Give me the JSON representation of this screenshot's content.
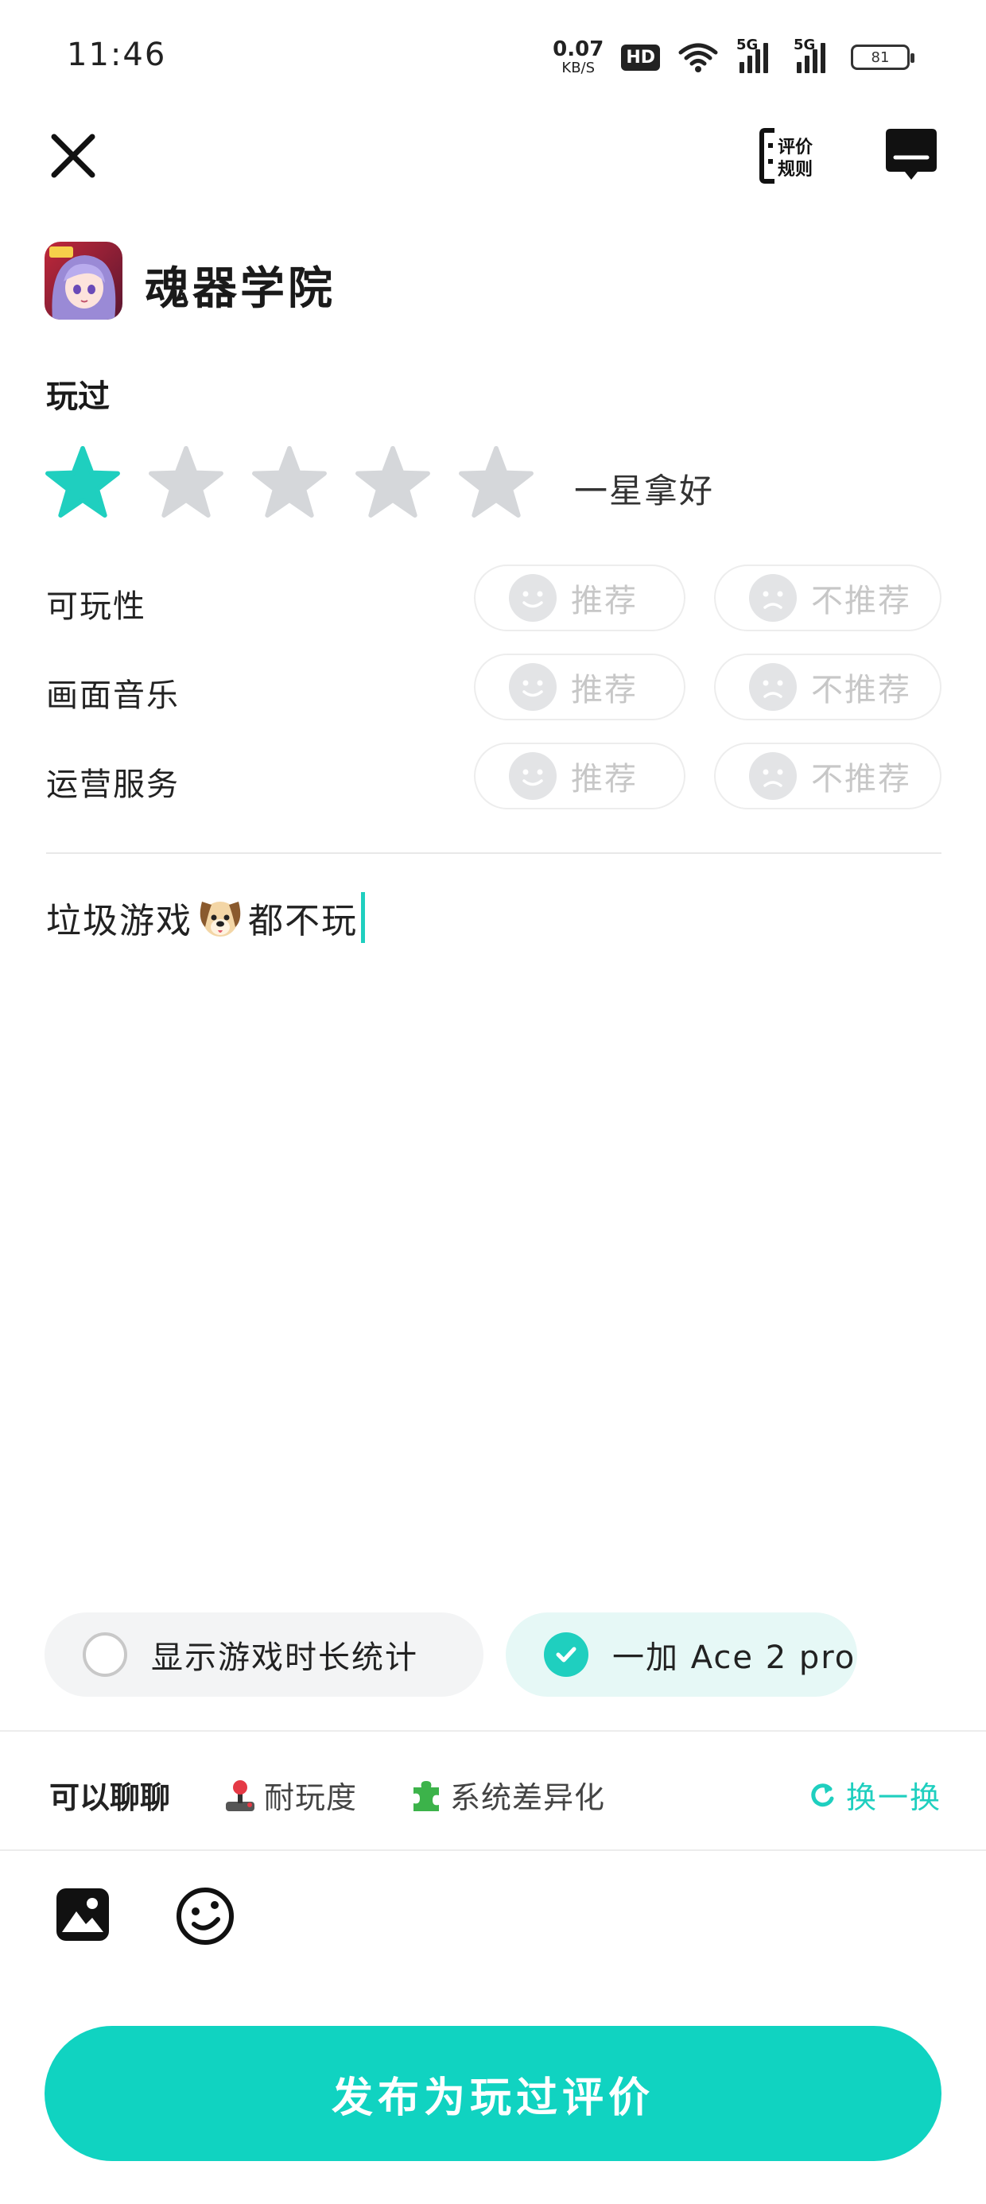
{
  "status_bar": {
    "time": "11:46",
    "net_speed_value": "0.07",
    "net_speed_unit": "KB/S",
    "hd_badge": "HD",
    "signal1_label": "5G",
    "signal2_label": "5G",
    "battery": "81"
  },
  "header": {
    "rules_label_line1": "评价",
    "rules_label_line2": "规则"
  },
  "game": {
    "title": "魂器学院"
  },
  "rating": {
    "section_label": "玩过",
    "stars_total": 5,
    "stars_selected": 1,
    "text": "一星拿好",
    "accent_color": "#1fcfbf",
    "inactive_color": "#d5d7da"
  },
  "aspects": [
    {
      "label": "可玩性",
      "recommend": "推荐",
      "not_recommend": "不推荐"
    },
    {
      "label": "画面音乐",
      "recommend": "推荐",
      "not_recommend": "不推荐"
    },
    {
      "label": "运营服务",
      "recommend": "推荐",
      "not_recommend": "不推荐"
    }
  ],
  "review": {
    "text_before_emoji": "垃圾游戏",
    "emoji": "dog-face",
    "text_after_emoji": "都不玩"
  },
  "options": {
    "playtime_label": "显示游戏时长统计",
    "playtime_checked": false,
    "device_label": "一加 Ace 2 pro",
    "device_checked": true
  },
  "topics": {
    "lead": "可以聊聊",
    "items": [
      {
        "icon": "joystick-icon",
        "label": "耐玩度"
      },
      {
        "icon": "puzzle-icon",
        "label": "系统差异化"
      }
    ],
    "refresh_label": "换一换"
  },
  "toolbar": {
    "image_icon": "image-icon",
    "emoji_icon": "emoji-icon"
  },
  "publish_button": "发布为玩过评价"
}
